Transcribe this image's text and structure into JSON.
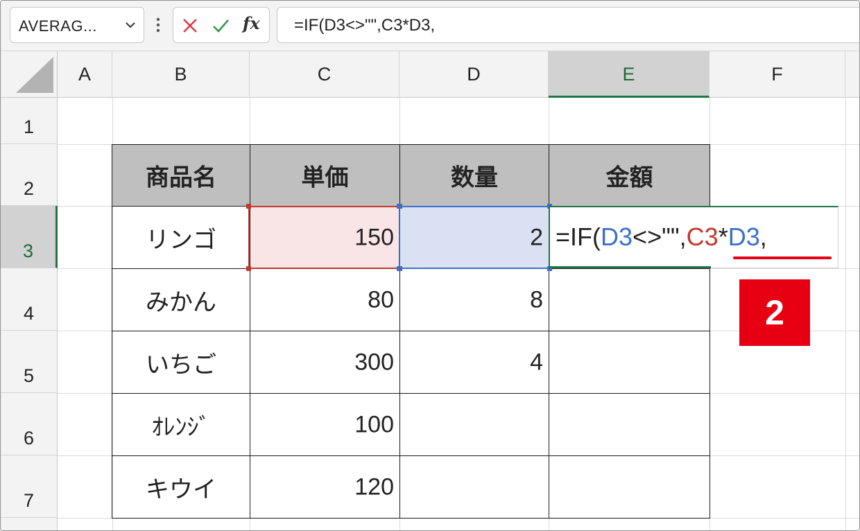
{
  "formula_bar": {
    "name_box": "AVERAG...",
    "formula": "=IF(D3<>\"\",C3*D3,",
    "fx_label": "fx"
  },
  "columns": [
    "A",
    "B",
    "C",
    "D",
    "E",
    "F"
  ],
  "selected_column": "E",
  "rows": [
    "1",
    "2",
    "3",
    "4",
    "5",
    "6",
    "7"
  ],
  "selected_row": "3",
  "table": {
    "headers": [
      "商品名",
      "単価",
      "数量",
      "金額"
    ],
    "rows": [
      {
        "name": "リンゴ",
        "price": "150",
        "qty": "2"
      },
      {
        "name": "みかん",
        "price": "80",
        "qty": "8"
      },
      {
        "name": "いちご",
        "price": "300",
        "qty": "4"
      },
      {
        "name": "ｵﾚﾝｼﾞ",
        "price": "100",
        "qty": ""
      },
      {
        "name": "キウイ",
        "price": "120",
        "qty": ""
      }
    ]
  },
  "in_cell_edit": {
    "parts": [
      {
        "text": "=IF(",
        "color": "#222222"
      },
      {
        "text": "D3",
        "color": "#3a70c9"
      },
      {
        "text": "<>\"\",",
        "color": "#222222"
      },
      {
        "text": "C3",
        "color": "#c0392b"
      },
      {
        "text": "*",
        "color": "#222222"
      },
      {
        "text": "D3",
        "color": "#3a70c9"
      },
      {
        "text": ",",
        "color": "#222222"
      }
    ]
  },
  "annotation": {
    "badge": "2",
    "color": "#e60012"
  },
  "colors": {
    "excel_green": "#217346",
    "ref_red": "#c0392b",
    "ref_blue": "#3a70c9",
    "header_fill": "#bfbfbf"
  }
}
